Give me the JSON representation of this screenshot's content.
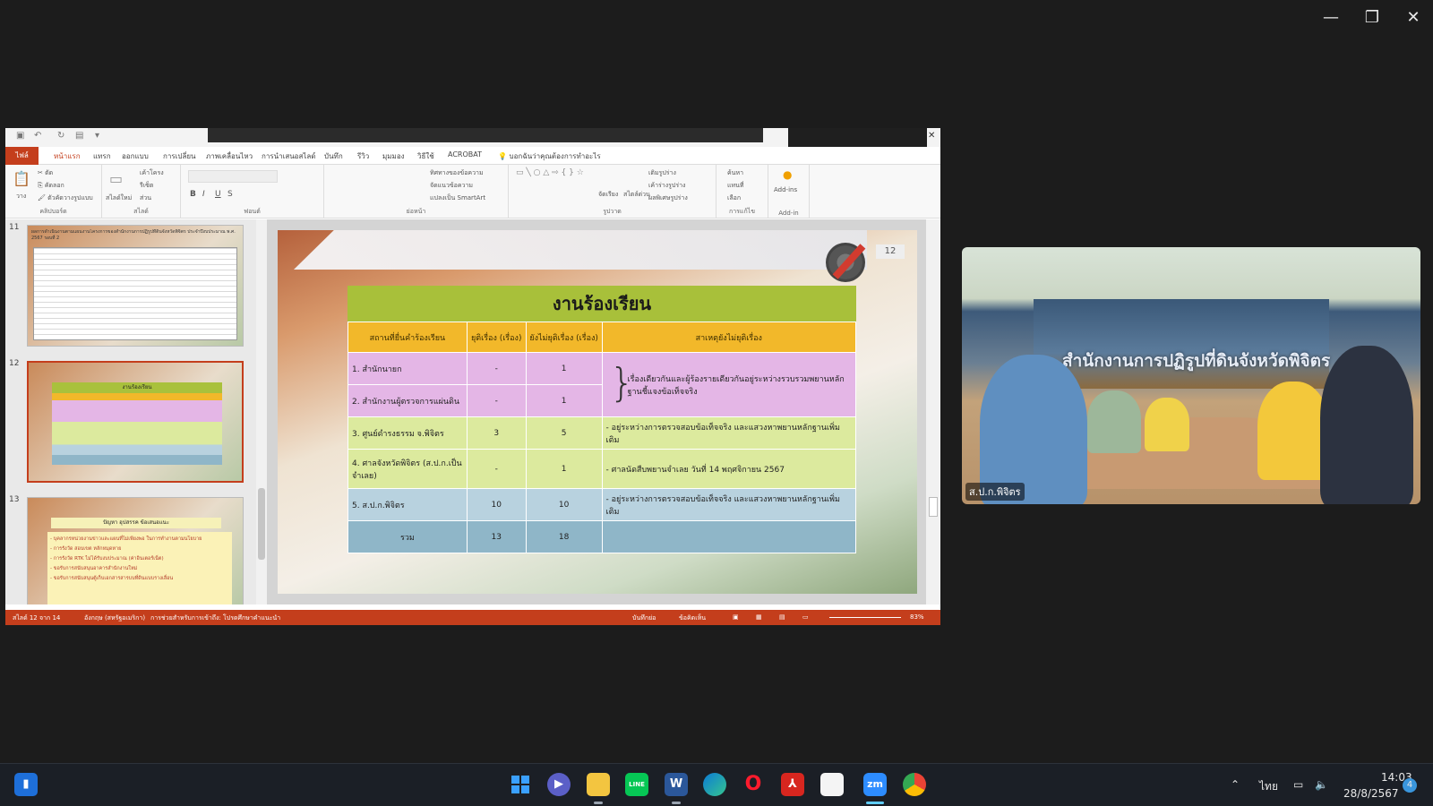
{
  "window_controls": {
    "minimize": "—",
    "restore": "❐",
    "close": "✕"
  },
  "ppt": {
    "qat_more": "▾",
    "tabs": [
      "ไฟล์",
      "หน้าแรก",
      "แทรก",
      "ออกแบบ",
      "การเปลี่ยน",
      "ภาพเคลื่อนไหว",
      "การนำเสนอสไลด์",
      "บันทึก",
      "รีวิว",
      "มุมมอง",
      "วิธีใช้",
      "ACROBAT",
      "บอกฉันว่าคุณต้องการทำอะไร"
    ],
    "ribbon": {
      "clipboard": {
        "label": "คลิปบอร์ด",
        "paste": "วาง",
        "cut": "ตัด",
        "copy": "คัดลอก",
        "format": "ตัวคัดวางรูปแบบ"
      },
      "slides": {
        "label": "สไลด์",
        "new": "สไลด์ใหม่",
        "layout": "เค้าโครง",
        "reset": "รีเซ็ต",
        "section": "ส่วน"
      },
      "font": {
        "label": "ฟอนต์",
        "bold": "B",
        "italic": "I",
        "underline": "U",
        "shadow": "S"
      },
      "paragraph": {
        "label": "ย่อหน้า",
        "direction": "ทิศทางของข้อความ",
        "align": "จัดแนวข้อความ",
        "smartart": "แปลงเป็น SmartArt"
      },
      "drawing": {
        "label": "รูปวาด",
        "arrange": "จัดเรียง",
        "quick_styles": "สไตล์ด่วน",
        "fill": "เติมรูปร่าง",
        "outline": "เค้าร่างรูปร่าง",
        "effects": "ผลพิเศษรูปร่าง"
      },
      "editing": {
        "label": "การแก้ไข",
        "find": "ค้นหา",
        "replace": "แทนที่",
        "select": "เลือก"
      },
      "addin": {
        "label": "Add-in",
        "addins": "Add-ins"
      }
    },
    "thumbnails": [
      {
        "num": "11",
        "title": "ผลการดำเนินงานตามแผนงานโครงการของสำนักงานการปฏิรูปที่ดินจังหวัดพิจิตร ประจำปีงบประมาณ พ.ศ. 2567 รอบที่ 2"
      },
      {
        "num": "12",
        "title": "งานร้องเรียน"
      },
      {
        "num": "13",
        "title": "ปัญหา อุปสรรค ข้อเสนอแนะ",
        "bullets": [
          "บุคลากรหน่วยงานข่าวและแผนที่ไม่เพียงพอ ในการทำงานตามนโยบาย",
          "การรังวัด สอบเขต หลักหมุดหาย",
          "การรังวัด RTK ไม่ได้รับงบประมาณ (ค่าอินเตอร์เน็ต)",
          "ขอรับการสนับสนุนอาคารสำนักงานใหม่",
          "ขอรับการสนับสนุนตู้เก็บเอกสารสารบบที่ดินแบบรางเลื่อน"
        ]
      }
    ],
    "slide": {
      "page": "12",
      "title": "งานร้องเรียน",
      "headers": [
        "สถานที่ยื่นคำร้องเรียน",
        "ยุติเรื่อง (เรื่อง)",
        "ยังไม่ยุติเรื่อง (เรื่อง)",
        "สาเหตุยังไม่ยุติเรื่อง"
      ],
      "rows": [
        {
          "place": "1. สำนักนายก",
          "done": "-",
          "pending": "1"
        },
        {
          "place": "2. สำนักงานผู้ตรวจการแผ่นดิน",
          "done": "-",
          "pending": "1"
        },
        {
          "place": "3. ศูนย์ดำรงธรรม จ.พิจิตร",
          "done": "3",
          "pending": "5",
          "reason": "- อยู่ระหว่างการตรวจสอบข้อเท็จจริง และแสวงหาพยานหลักฐานเพิ่มเติม"
        },
        {
          "place": "4. ศาลจังหวัดพิจิตร (ส.ป.ก.เป็นจำเลย)",
          "done": "-",
          "pending": "1",
          "reason": "- ศาลนัดสืบพยานจำเลย วันที่ 14 พฤศจิกายน 2567"
        },
        {
          "place": "5. ส.ป.ก.พิจิตร",
          "done": "10",
          "pending": "10",
          "reason": "- อยู่ระหว่างการตรวจสอบข้อเท็จจริง และแสวงหาพยานหลักฐานเพิ่มเติม"
        }
      ],
      "merged_reason": "เรื่องเดียวกันและผู้ร้องรายเดียวกันอยู่ระหว่างรวบรวมพยานหลักฐานชี้แจงข้อเท็จจริง",
      "total": {
        "label": "รวม",
        "done": "13",
        "pending": "18"
      }
    },
    "status": {
      "slide_of": "สไลด์ 12 จาก 14",
      "language": "อังกฤษ (สหรัฐอเมริกา)",
      "accessibility": "การช่วยสำหรับการเข้าถึง: โปรดศึกษาคำแนะนำ",
      "notes": "บันทึกย่อ",
      "comments": "ข้อคิดเห็น",
      "zoom": "83%"
    }
  },
  "video": {
    "participant": "ส.ป.ก.พิจิตร",
    "sign_text": "สำนักงานการปฏิรูปที่ดินจังหวัดพิจิตร"
  },
  "taskbar": {
    "apps": [
      "start",
      "zoom-chat",
      "file-explorer",
      "line",
      "word",
      "edge",
      "opera",
      "acrobat",
      "notepad",
      "zoom",
      "chrome"
    ],
    "zoom_label": "zm",
    "word_label": "W",
    "line_label": "LINE",
    "language": "ไทย",
    "time": "14:03",
    "date": "28/8/2567",
    "notifications": "4"
  }
}
